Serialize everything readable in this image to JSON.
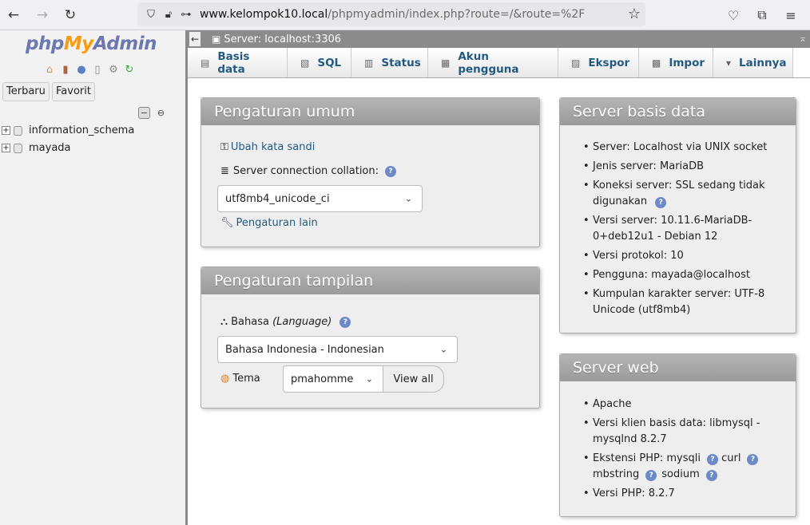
{
  "browser": {
    "url_host": "www.kelompok10.local",
    "url_path": "/phpmyadmin/index.php?route=/&route=%2F"
  },
  "sidebar": {
    "logo": {
      "php": "php",
      "my": "My",
      "admin": "Admin"
    },
    "recent_label": "Terbaru",
    "favorites_label": "Favorit",
    "databases": [
      "information_schema",
      "mayada"
    ]
  },
  "serverbar": {
    "label": "Server: localhost:3306"
  },
  "tabs": [
    {
      "label": "Basis data",
      "icon": "database-icon"
    },
    {
      "label": "SQL",
      "icon": "sql-icon"
    },
    {
      "label": "Status",
      "icon": "status-icon"
    },
    {
      "label": "Akun pengguna",
      "icon": "users-icon"
    },
    {
      "label": "Ekspor",
      "icon": "export-icon"
    },
    {
      "label": "Impor",
      "icon": "import-icon"
    },
    {
      "label": "Lainnya",
      "icon": "chevron-down-icon"
    }
  ],
  "general": {
    "title": "Pengaturan umum",
    "change_password": "Ubah kata sandi",
    "collation_label": "Server connection collation:",
    "collation_value": "utf8mb4_unicode_ci",
    "more_settings": "Pengaturan lain"
  },
  "appearance": {
    "title": "Pengaturan tampilan",
    "language_label": "Bahasa ",
    "language_label_en": "(Language)",
    "language_value": "Bahasa Indonesia - Indonesian",
    "theme_label": "Tema",
    "theme_value": "pmahomme",
    "view_all": "View all"
  },
  "db_server": {
    "title": "Server basis data",
    "items": [
      "Server: Localhost via UNIX socket",
      "Jenis server: MariaDB",
      "Koneksi server: SSL sedang tidak digunakan",
      "Versi server: 10.11.6-MariaDB-0+deb12u1 - Debian 12",
      "Versi protokol: 10",
      "Pengguna: mayada@localhost",
      "Kumpulan karakter server: UTF-8 Unicode (utf8mb4)"
    ]
  },
  "web_server": {
    "title": "Server web",
    "items": [
      "Apache",
      "Versi klien basis data: libmysql - mysqlnd 8.2.7",
      "Ekstensi PHP: mysqli",
      "Versi PHP: 8.2.7"
    ],
    "ext_curl": "curl",
    "ext_mbstring": "mbstring",
    "ext_sodium": "sodium"
  }
}
